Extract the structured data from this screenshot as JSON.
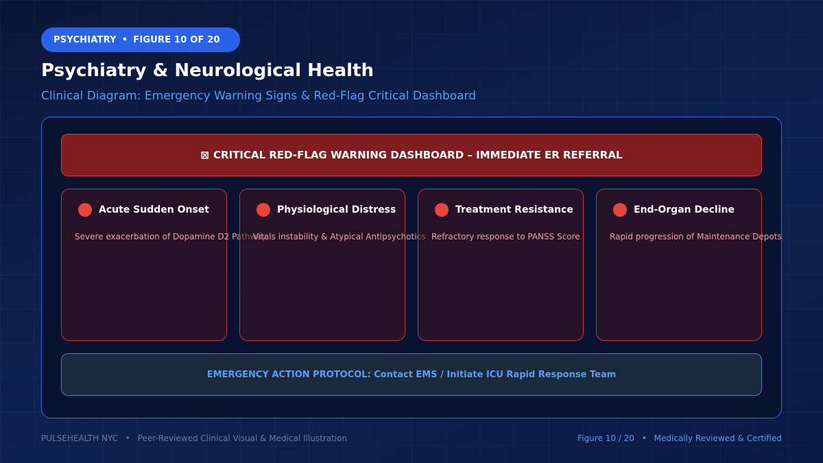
{
  "header": {
    "pill": {
      "section": "PSYCHIATRY",
      "separator": "•",
      "figure": "FIGURE 10 OF 20"
    },
    "title": "Psychiatry & Neurological Health",
    "subtitle": "Clinical Diagram: Emergency Warning Signs & Red-Flag Critical Dashboard"
  },
  "dashboard": {
    "banner": {
      "icon": "⊠",
      "text": "CRITICAL RED-FLAG WARNING DASHBOARD – IMMEDIATE ER REFERRAL"
    },
    "cards": [
      {
        "title": "Acute Sudden Onset",
        "description": "Severe exacerbation of Dopamine D2 Pathway"
      },
      {
        "title": "Physiological Distress",
        "description": "Vitals instability & Atypical Antipsychotics"
      },
      {
        "title": "Treatment Resistance",
        "description": "Refractory response to PANSS Score"
      },
      {
        "title": "End-Organ Decline",
        "description": "Rapid progression of Maintenance Depots"
      }
    ],
    "protocol": "EMERGENCY ACTION PROTOCOL: Contact EMS / Initiate ICU Rapid Response Team"
  },
  "footer": {
    "left": {
      "brand": "PULSEHEALTH NYC",
      "separator": "•",
      "tagline": "Peer-Reviewed Clinical Visual & Medical Illustration"
    },
    "right": {
      "figure": "Figure 10 / 20",
      "separator": "•",
      "status": "Medically Reviewed & Certified"
    }
  },
  "colors": {
    "accent_blue": "#2a63e6",
    "alert_red": "#e8453f",
    "banner_red": "#7f1c1f",
    "link_blue": "#5b9cf5"
  }
}
